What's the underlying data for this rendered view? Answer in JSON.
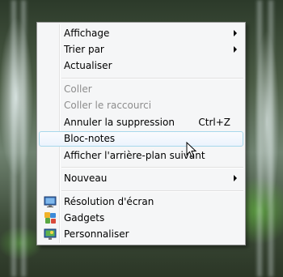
{
  "context_menu": {
    "items": [
      {
        "label": "Affichage",
        "submenu": true
      },
      {
        "label": "Trier par",
        "submenu": true
      },
      {
        "label": "Actualiser"
      },
      {
        "label": "Coller",
        "disabled": true
      },
      {
        "label": "Coller le raccourci",
        "disabled": true
      },
      {
        "label": "Annuler la suppression",
        "shortcut": "Ctrl+Z"
      },
      {
        "label": "Bloc-notes",
        "highlighted": true
      },
      {
        "label": "Afficher l'arrière-plan suivant"
      },
      {
        "label": "Nouveau",
        "submenu": true
      },
      {
        "label": "Résolution d'écran",
        "icon": "display-icon"
      },
      {
        "label": "Gadgets",
        "icon": "gadgets-icon"
      },
      {
        "label": "Personnaliser",
        "icon": "personalize-icon"
      }
    ]
  },
  "colors": {
    "menu_bg": "#f5f6f7",
    "highlight_border": "#a8d8eb",
    "disabled_text": "#8d8d8d"
  }
}
